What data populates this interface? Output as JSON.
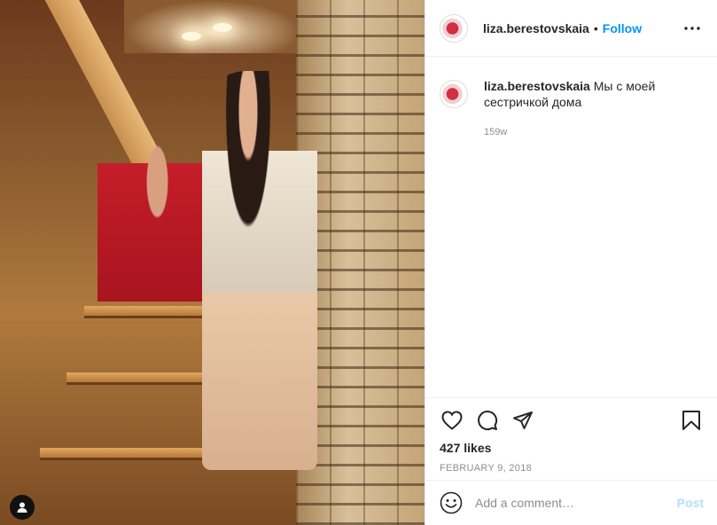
{
  "header": {
    "username": "liza.berestovskaia",
    "separator": "•",
    "follow_label": "Follow",
    "more_icon": "more-horizontal-icon"
  },
  "caption": {
    "username": "liza.berestovskaia",
    "text": "Мы с моей сестричкой дома",
    "time_ago": "159w"
  },
  "actions": {
    "icons": [
      "heart-icon",
      "comment-icon",
      "share-icon",
      "bookmark-icon"
    ],
    "likes": "427 likes",
    "date": "FEBRUARY 9, 2018"
  },
  "comment_box": {
    "placeholder": "Add a comment…",
    "post_label": "Post"
  },
  "colors": {
    "accent": "#0095f6",
    "post_disabled": "#b2dffc",
    "muted": "#8e8e8e"
  }
}
